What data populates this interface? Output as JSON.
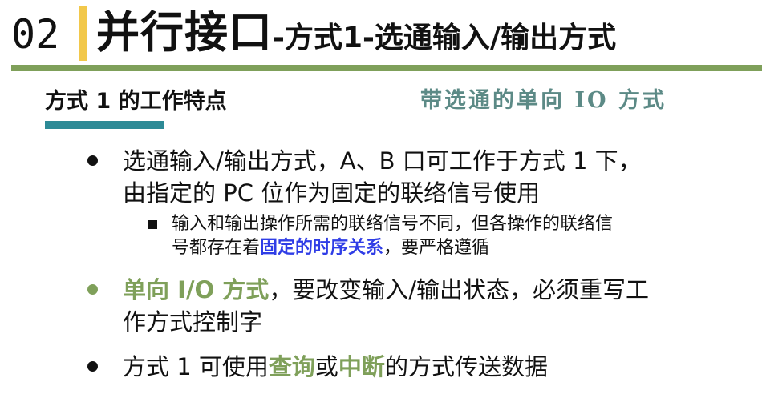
{
  "header": {
    "section_number": "02",
    "title": "并行接口",
    "subtitle": "-方式1-选通输入/输出方式"
  },
  "subheading": "方式 1 的工作特点",
  "tagline": "带选通的单向 IO 方式",
  "bullets": [
    {
      "line1": "选通输入/输出方式，A、B 口可工作于方式 1 下，",
      "line2": "由指定的 PC 位作为固定的联络信号使用",
      "sub": {
        "line1": "输入和输出操作所需的联络信号不同，但各操作的联络信",
        "line2_pre": "号都存在着",
        "line2_hl": "固定的时序关系",
        "line2_post": "，要严格遵循"
      }
    },
    {
      "hl": "单向 I/O 方式",
      "line1_rest": "，要改变输入/输出状态，必须重写工",
      "line2": "作方式控制字"
    },
    {
      "pre": "方式 1 可使用",
      "hl1": "查询",
      "mid": "或",
      "hl2": "中断",
      "post": "的方式传送数据"
    }
  ],
  "colors": {
    "accent_green": "#7fa05a",
    "accent_yellow": "#f2c84b",
    "accent_teal": "#2d8a96",
    "highlight_blue": "#2f3de6",
    "tagline_color": "#5c8a86"
  }
}
